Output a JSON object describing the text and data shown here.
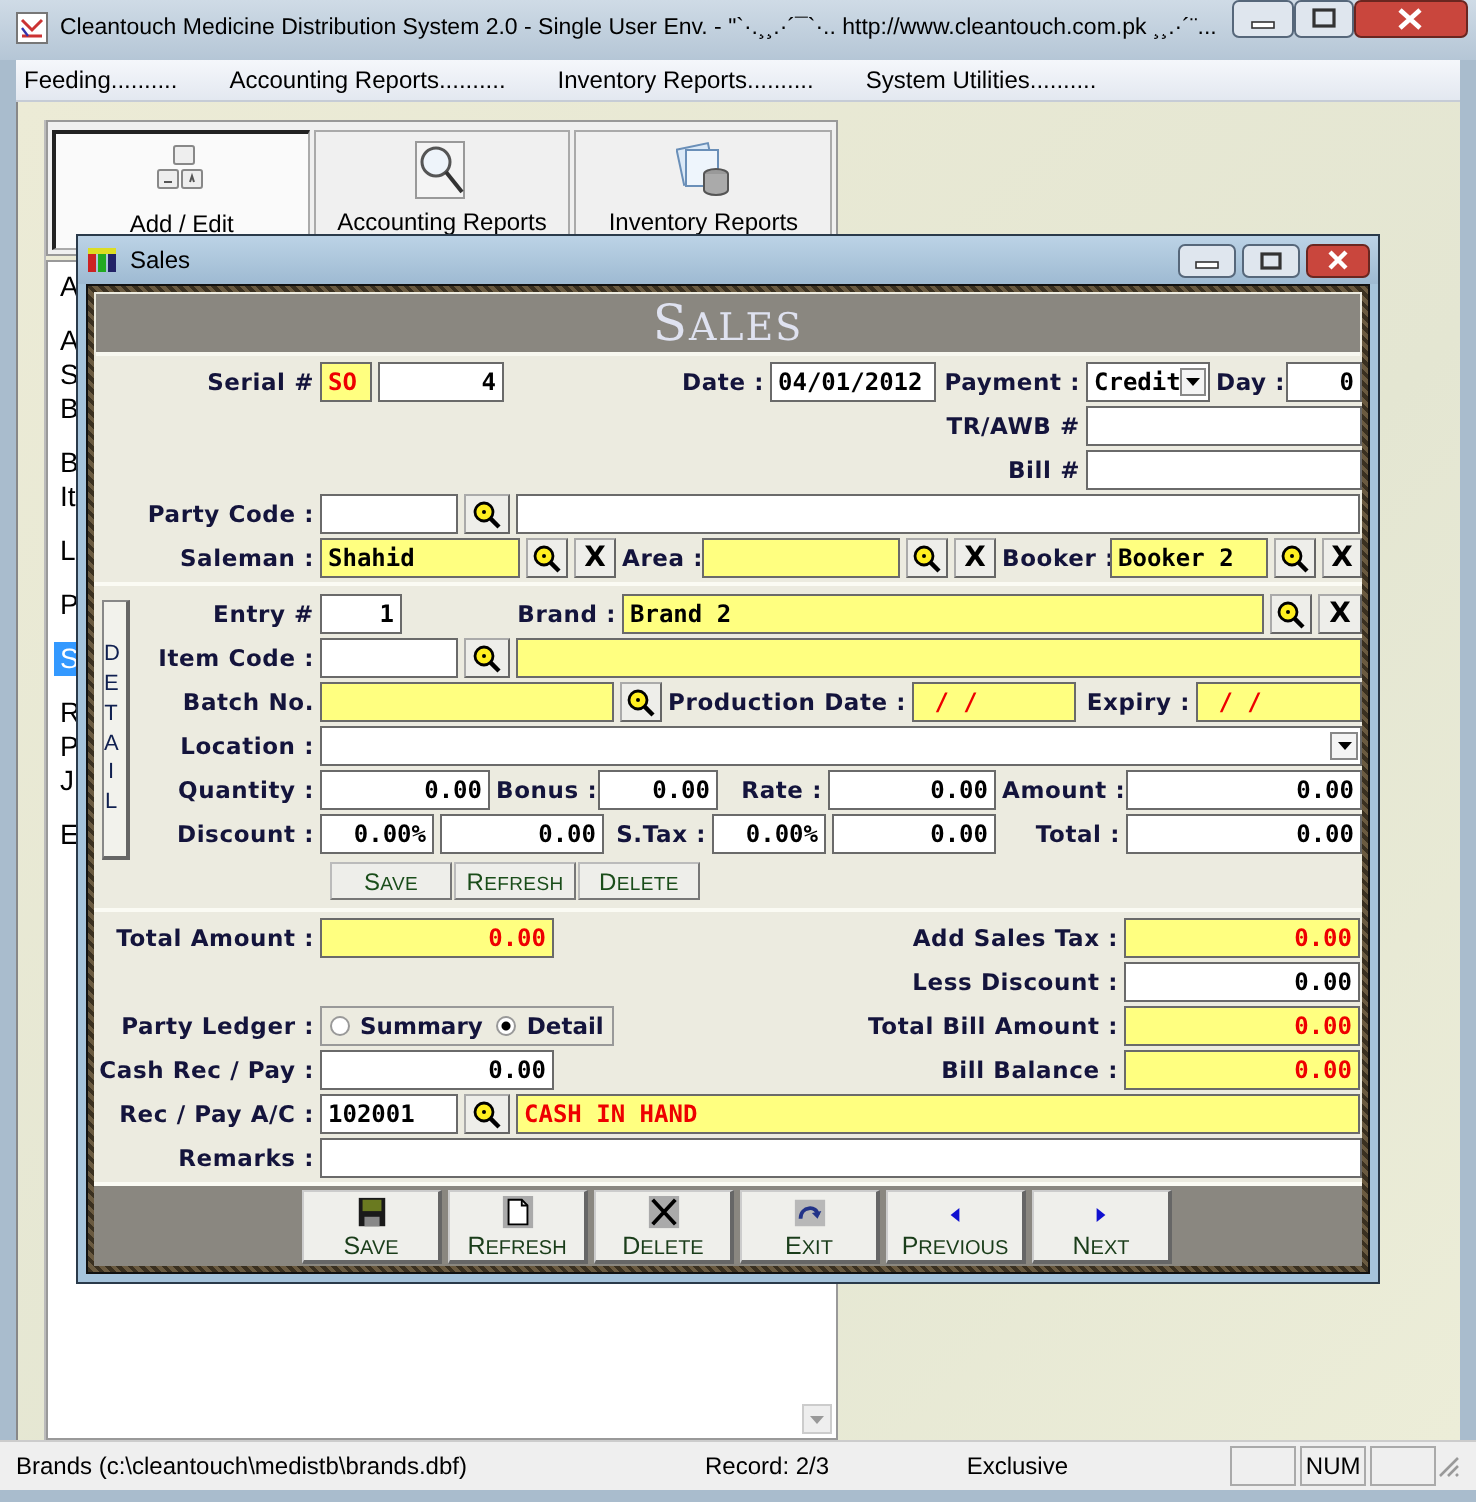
{
  "window": {
    "title": "Cleantouch Medicine Distribution System 2.0 - Single User Env.  -  \"`·.¸¸.·´¯`·.. http://www.cleantouch.com.pk ¸¸.·´¨..."
  },
  "menu": [
    {
      "label": "Feeding.........."
    },
    {
      "label": "Accounting Reports.........."
    },
    {
      "label": "Inventory Reports.........."
    },
    {
      "label": "System Utilities.........."
    }
  ],
  "toolbar_tabs": [
    {
      "label": "Add / Edit",
      "kind": "keys",
      "selected": true
    },
    {
      "label": "Accounting Reports",
      "kind": "magnifier",
      "selected": false
    },
    {
      "label": "Inventory Reports",
      "kind": "database",
      "selected": false
    }
  ],
  "list_groups": [
    [
      {
        "label": "A",
        "selected": false
      }
    ],
    [
      {
        "label": "A",
        "selected": false
      },
      {
        "label": "S",
        "selected": false
      },
      {
        "label": "B",
        "selected": false
      }
    ],
    [
      {
        "label": "B",
        "selected": false
      },
      {
        "label": "It",
        "selected": false
      }
    ],
    [
      {
        "label": "L",
        "selected": false
      }
    ],
    [
      {
        "label": "P",
        "selected": false
      }
    ],
    [
      {
        "label": "S",
        "selected": true
      }
    ],
    [
      {
        "label": "R",
        "selected": false
      },
      {
        "label": "P",
        "selected": false
      },
      {
        "label": "J",
        "selected": false
      }
    ],
    [
      {
        "label": "E",
        "selected": false
      }
    ]
  ],
  "dialog": {
    "title": "Sales",
    "heading": "SALES",
    "header_rows": [
      [
        {
          "kind": "label",
          "text": "Serial #"
        },
        {
          "kind": "field",
          "value": "SO",
          "highlighted": true,
          "alert": true
        },
        {
          "kind": "number",
          "value": "4",
          "highlighted": false,
          "alert": false
        },
        {
          "kind": "label",
          "text": "Date :"
        },
        {
          "kind": "field",
          "value": "04/01/2012",
          "highlighted": false,
          "alert": false
        },
        {
          "kind": "label",
          "text": "Payment :"
        },
        {
          "kind": "combo",
          "value": "Credit"
        },
        {
          "kind": "label",
          "text": "Day :"
        },
        {
          "kind": "number",
          "value": "0",
          "highlighted": false,
          "alert": false
        }
      ],
      [
        {
          "kind": "label",
          "text": "TR/AWB #"
        },
        {
          "kind": "field",
          "highlighted": false
        }
      ],
      [
        {
          "kind": "label",
          "text": "Bill #"
        },
        {
          "kind": "field",
          "highlighted": false
        }
      ],
      [
        {
          "kind": "label",
          "text": "Party Code :"
        },
        {
          "kind": "field",
          "highlighted": false
        },
        {
          "kind": "lookup"
        },
        {
          "kind": "field",
          "highlighted": false
        }
      ],
      [
        {
          "kind": "label",
          "text": "Saleman :"
        },
        {
          "kind": "field",
          "value": "Shahid",
          "highlighted": true,
          "alert": false
        },
        {
          "kind": "lookup"
        },
        {
          "kind": "clear",
          "text": "X"
        },
        {
          "kind": "label",
          "text": "Area :"
        },
        {
          "kind": "field",
          "highlighted": true
        },
        {
          "kind": "lookup"
        },
        {
          "kind": "clear",
          "text": "X"
        },
        {
          "kind": "label",
          "text": "Booker :"
        },
        {
          "kind": "field",
          "value": "Booker 2",
          "highlighted": true,
          "alert": false
        },
        {
          "kind": "lookup"
        },
        {
          "kind": "clear",
          "text": "X"
        }
      ]
    ],
    "detail_tab": "DETAIL",
    "detail_rows": [
      [
        {
          "kind": "label",
          "text": "Entry #"
        },
        {
          "kind": "number",
          "value": "1",
          "highlighted": false,
          "alert": false
        },
        {
          "kind": "label",
          "text": "Brand :"
        },
        {
          "kind": "field",
          "value": "Brand 2",
          "highlighted": true,
          "alert": false
        },
        {
          "kind": "lookup"
        },
        {
          "kind": "clear",
          "text": "X"
        }
      ],
      [
        {
          "kind": "label",
          "text": "Item Code :"
        },
        {
          "kind": "field",
          "highlighted": false
        },
        {
          "kind": "lookup"
        },
        {
          "kind": "field",
          "highlighted": true
        }
      ],
      [
        {
          "kind": "label",
          "text": "Batch No."
        },
        {
          "kind": "field",
          "highlighted": true
        },
        {
          "kind": "lookup"
        },
        {
          "kind": "label",
          "text": "Production Date :"
        },
        {
          "kind": "field",
          "value": " / /",
          "highlighted": true,
          "alert": true
        },
        {
          "kind": "label",
          "text": "Expiry :"
        },
        {
          "kind": "field",
          "value": " / /",
          "highlighted": true,
          "alert": true
        }
      ],
      [
        {
          "kind": "label",
          "text": "Location :"
        },
        {
          "kind": "combo"
        }
      ],
      [
        {
          "kind": "label",
          "text": "Quantity :"
        },
        {
          "kind": "number",
          "value": "0.00",
          "highlighted": false,
          "alert": false
        },
        {
          "kind": "label",
          "text": "Bonus :"
        },
        {
          "kind": "number",
          "value": "0.00",
          "highlighted": false,
          "alert": false
        },
        {
          "kind": "label",
          "text": "Rate :"
        },
        {
          "kind": "number",
          "value": "0.00",
          "highlighted": false,
          "alert": false
        },
        {
          "kind": "label",
          "text": "Amount :"
        },
        {
          "kind": "number",
          "value": "0.00",
          "highlighted": false,
          "alert": false
        }
      ],
      [
        {
          "kind": "label",
          "text": "Discount :"
        },
        {
          "kind": "number",
          "value": "0.00%",
          "highlighted": false,
          "alert": false
        },
        {
          "kind": "number",
          "value": "0.00",
          "highlighted": false,
          "alert": false
        },
        {
          "kind": "label",
          "text": "S.Tax :"
        },
        {
          "kind": "number",
          "value": "0.00%",
          "highlighted": false,
          "alert": false
        },
        {
          "kind": "number",
          "value": "0.00",
          "highlighted": false,
          "alert": false
        },
        {
          "kind": "label",
          "text": "Total :"
        },
        {
          "kind": "number",
          "value": "0.00",
          "highlighted": false,
          "alert": false
        }
      ]
    ],
    "detail_buttons": [
      "SAVE",
      "REFRESH",
      "DELETE"
    ],
    "total_rows": [
      [
        {
          "kind": "label",
          "text": "Total Amount :"
        },
        {
          "kind": "number",
          "value": "0.00",
          "highlighted": true,
          "alert": true
        },
        {
          "kind": "label",
          "text": "Add Sales Tax :"
        },
        {
          "kind": "number",
          "value": "0.00",
          "highlighted": true,
          "alert": true
        }
      ],
      [
        {
          "kind": "label",
          "text": "Less Discount :"
        },
        {
          "kind": "number",
          "value": "0.00",
          "highlighted": false,
          "alert": false
        }
      ],
      [
        {
          "kind": "label",
          "text": "Party Ledger :"
        },
        {
          "kind": "radio-group",
          "options": [
            {
              "label": "Summary",
              "selected": false
            },
            {
              "label": "Detail",
              "selected": true
            }
          ]
        },
        {
          "kind": "label",
          "text": "Total Bill Amount :"
        },
        {
          "kind": "number",
          "value": "0.00",
          "highlighted": true,
          "alert": true
        }
      ],
      [
        {
          "kind": "label",
          "text": "Cash Rec / Pay :"
        },
        {
          "kind": "number",
          "value": "0.00",
          "highlighted": false,
          "alert": false
        },
        {
          "kind": "label",
          "text": "Bill Balance :"
        },
        {
          "kind": "number",
          "value": "0.00",
          "highlighted": true,
          "alert": true
        }
      ],
      [
        {
          "kind": "label",
          "text": "Rec / Pay A/C :"
        },
        {
          "kind": "field",
          "value": "102001",
          "highlighted": false,
          "alert": false
        },
        {
          "kind": "lookup"
        },
        {
          "kind": "field",
          "value": "CASH IN HAND",
          "highlighted": true,
          "alert": true
        }
      ],
      [
        {
          "kind": "label",
          "text": "Remarks :"
        },
        {
          "kind": "field",
          "highlighted": false
        }
      ]
    ],
    "buttons": [
      {
        "label": "SAVE",
        "kind": "save"
      },
      {
        "label": "REFRESH",
        "kind": "refresh"
      },
      {
        "label": "DELETE",
        "kind": "delete"
      },
      {
        "label": "EXIT",
        "kind": "exit"
      },
      {
        "label": "PREVIOUS",
        "kind": "previous"
      },
      {
        "label": "NEXT",
        "kind": "next"
      }
    ]
  },
  "status_bar": {
    "file": "Brands (c:\\cleantouch\\medistb\\brands.dbf)",
    "record": "Record: 2/3",
    "mode": "Exclusive",
    "indicator": "NUM"
  }
}
